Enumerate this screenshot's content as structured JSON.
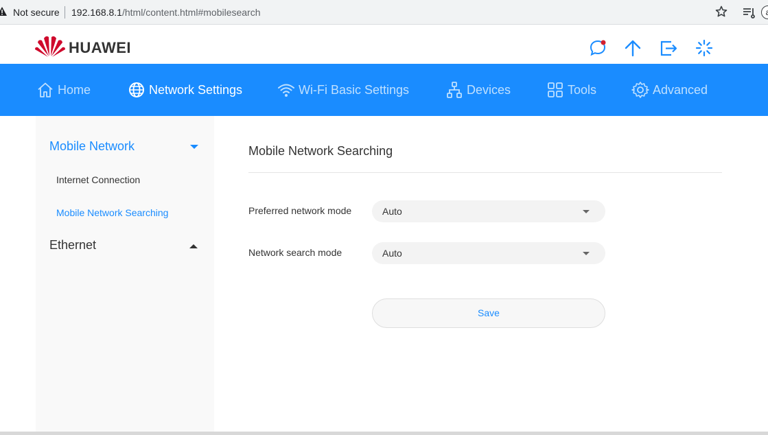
{
  "browser": {
    "security_label": "Not secure",
    "url_host": "192.168.8.1",
    "url_path": "/html/content.html#mobilesearch",
    "profile_initial": "a"
  },
  "header": {
    "brand": "HUAWEI",
    "brand_color": "#cf0a2c",
    "icons": [
      "message-icon",
      "upload-icon",
      "logout-icon",
      "loading-icon"
    ]
  },
  "nav": {
    "accent": "#1a8cff",
    "items": [
      {
        "label": "Home",
        "icon": "home-icon"
      },
      {
        "label": "Network Settings",
        "icon": "globe-icon",
        "active": true
      },
      {
        "label": "Wi-Fi Basic Settings",
        "icon": "wifi-icon"
      },
      {
        "label": "Devices",
        "icon": "devices-icon"
      },
      {
        "label": "Tools",
        "icon": "tools-icon"
      },
      {
        "label": "Advanced",
        "icon": "gear-icon"
      }
    ]
  },
  "sidebar": {
    "sections": [
      {
        "label": "Mobile Network",
        "expanded": true,
        "items": [
          {
            "label": "Internet Connection"
          },
          {
            "label": "Mobile Network Searching",
            "active": true
          }
        ]
      },
      {
        "label": "Ethernet",
        "expanded": false
      }
    ]
  },
  "main": {
    "title": "Mobile Network Searching",
    "fields": [
      {
        "label": "Preferred network mode",
        "value": "Auto"
      },
      {
        "label": "Network search mode",
        "value": "Auto"
      }
    ],
    "save_label": "Save"
  }
}
